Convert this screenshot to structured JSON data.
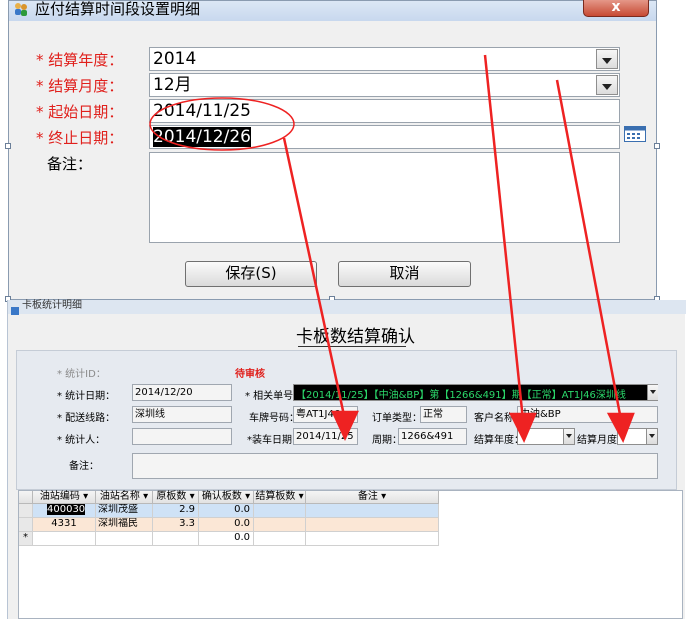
{
  "dialog1": {
    "title": "应付结算时间段设置明细",
    "close_label": "x",
    "fields": {
      "year_label": "* 结算年度：",
      "year_value": "2014",
      "month_label": "* 结算月度：",
      "month_value": "12月",
      "start_label": "* 起始日期：",
      "start_value": "2014/11/25",
      "end_label": "* 终止日期：",
      "end_value": "2014/12/26",
      "notes_label": "备注："
    },
    "save_label": "保存(S)",
    "cancel_label": "取消"
  },
  "window2": {
    "title": "卡板统计明细",
    "heading": "卡板数结算确认",
    "form": {
      "stat_id_label": "* 统计ID：",
      "status": "待审核",
      "stat_date_label": "* 统计日期：",
      "stat_date_value": "2014/12/20",
      "related_no_label": "* 相关单号：",
      "related_no_value": "【2014/11/25】【中油&BP】第【1266&491】期【正常】AT1J46深圳线",
      "route_label": "* 配送线路：",
      "route_value": "深圳线",
      "plate_label": "车牌号码：",
      "plate_value": "粤AT1J46",
      "order_type_label": "订单类型：",
      "order_type_value": "正常",
      "customer_label": "客户名称：",
      "customer_value": "中油&BP",
      "stat_person_label": "* 统计人：",
      "stat_person_value": "",
      "load_date_label": "*装车日期：",
      "load_date_value": "2014/11/25",
      "period_label": "周期：",
      "period_value": "1266&491",
      "year_label": "结算年度：",
      "month_label": "结算月度",
      "notes_label": "备注："
    },
    "grid": {
      "columns": [
        "油站编码",
        "油站名称",
        "原板数",
        "确认板数",
        "结算板数",
        "备注"
      ],
      "rows": [
        {
          "code": "400030",
          "name": "深圳茂盛",
          "orig": "2.9",
          "confirm": "0.0",
          "settle": "",
          "note": ""
        },
        {
          "code": "4331",
          "name": "深圳福民",
          "orig": "3.3",
          "confirm": "0.0",
          "settle": "",
          "note": ""
        },
        {
          "code": "",
          "name": "",
          "orig": "",
          "confirm": "0.0",
          "settle": "",
          "note": ""
        }
      ],
      "new_row_marker": "*"
    }
  },
  "colors": {
    "required_label": "#e0201c",
    "annotation_arrow": "#ee2222",
    "row_selected": "#cfe2f6",
    "row_alt": "#fbe7d6",
    "related_no_bg": "#000000",
    "related_no_fg": "#2bd96b"
  }
}
